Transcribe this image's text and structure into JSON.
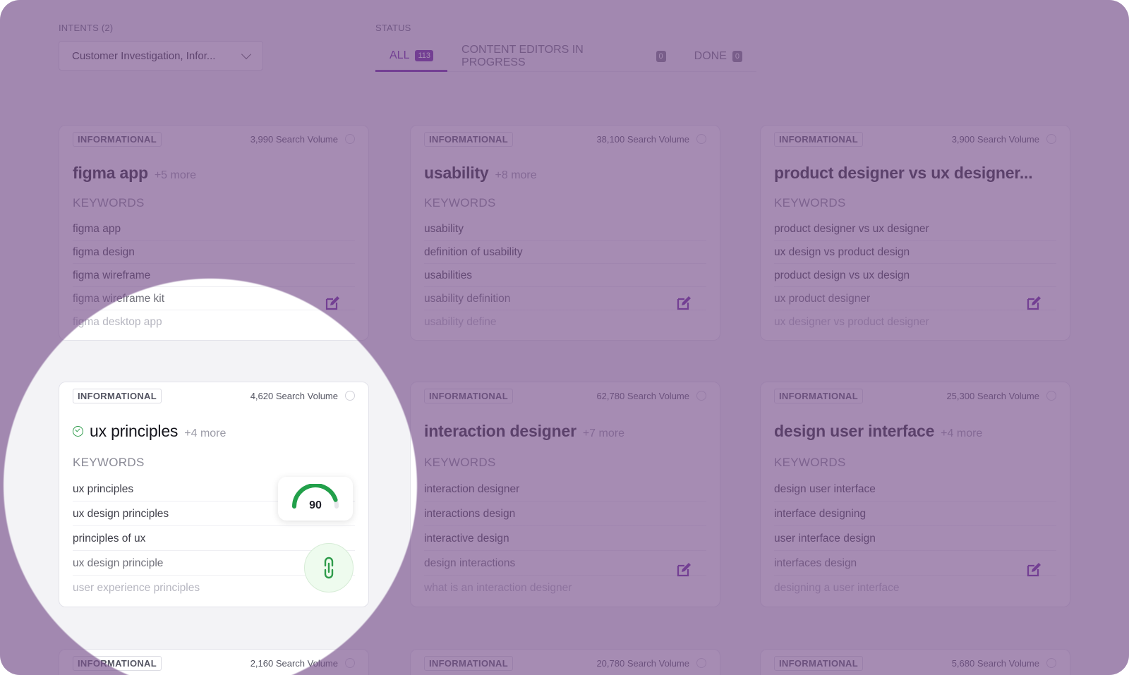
{
  "filters": {
    "intents_label": "INTENTS (2)",
    "intents_value": "Customer Investigation, Infor...",
    "status_label": "STATUS"
  },
  "tabs": [
    {
      "label": "ALL",
      "count": "113",
      "active": true
    },
    {
      "label": "CONTENT EDITORS IN PROGRESS",
      "count": "0",
      "active": false
    },
    {
      "label": "DONE",
      "count": "0",
      "active": false
    }
  ],
  "cards": [
    {
      "intent": "INFORMATIONAL",
      "volume": "3,990 Search Volume",
      "title": "figma app",
      "more": "+5 more",
      "keywords_label": "KEYWORDS",
      "keywords": [
        "figma app",
        "figma design",
        "figma wireframe",
        "figma wireframe kit",
        "figma desktop app"
      ]
    },
    {
      "intent": "INFORMATIONAL",
      "volume": "38,100 Search Volume",
      "title": "usability",
      "more": "+8 more",
      "keywords_label": "KEYWORDS",
      "keywords": [
        "usability",
        "definition of usability",
        "usabilities",
        "usability definition",
        "usability define"
      ]
    },
    {
      "intent": "INFORMATIONAL",
      "volume": "3,900 Search Volume",
      "title": "product designer vs ux designer...",
      "more": "",
      "keywords_label": "KEYWORDS",
      "keywords": [
        "product designer vs ux designer",
        "ux design vs product design",
        "product design vs ux design",
        "ux product designer",
        "ux designer vs product designer"
      ]
    },
    {
      "intent": "INFORMATIONAL",
      "volume": "4,620 Search Volume",
      "title": "ux principles",
      "more": "+4 more",
      "keywords_label": "KEYWORDS",
      "keywords": [
        "ux principles",
        "ux design principles",
        "principles of ux",
        "ux design principle",
        "user experience principles"
      ],
      "score": "90",
      "score_fraction": 0.9
    },
    {
      "intent": "INFORMATIONAL",
      "volume": "62,780 Search Volume",
      "title": "interaction designer",
      "more": "+7 more",
      "keywords_label": "KEYWORDS",
      "keywords": [
        "interaction designer",
        "interactions design",
        "interactive design",
        "design interactions",
        "what is an interaction designer"
      ]
    },
    {
      "intent": "INFORMATIONAL",
      "volume": "25,300 Search Volume",
      "title": "design user interface",
      "more": "+4 more",
      "keywords_label": "KEYWORDS",
      "keywords": [
        "design user interface",
        "interface designing",
        "user interface design",
        "interfaces design",
        "designing a user interface"
      ]
    },
    {
      "intent": "INFORMATIONAL",
      "volume": "2,160 Search Volume"
    },
    {
      "intent": "INFORMATIONAL",
      "volume": "20,780 Search Volume"
    },
    {
      "intent": "INFORMATIONAL",
      "volume": "5,680 Search Volume"
    }
  ],
  "colors": {
    "accent": "#6a1fa0",
    "success": "#2e9b4a",
    "overlay": "#78508c"
  },
  "icons": {
    "edit": "edit-icon",
    "link": "link-icon",
    "check": "check-circle-icon",
    "chevron": "chevron-down-icon"
  }
}
